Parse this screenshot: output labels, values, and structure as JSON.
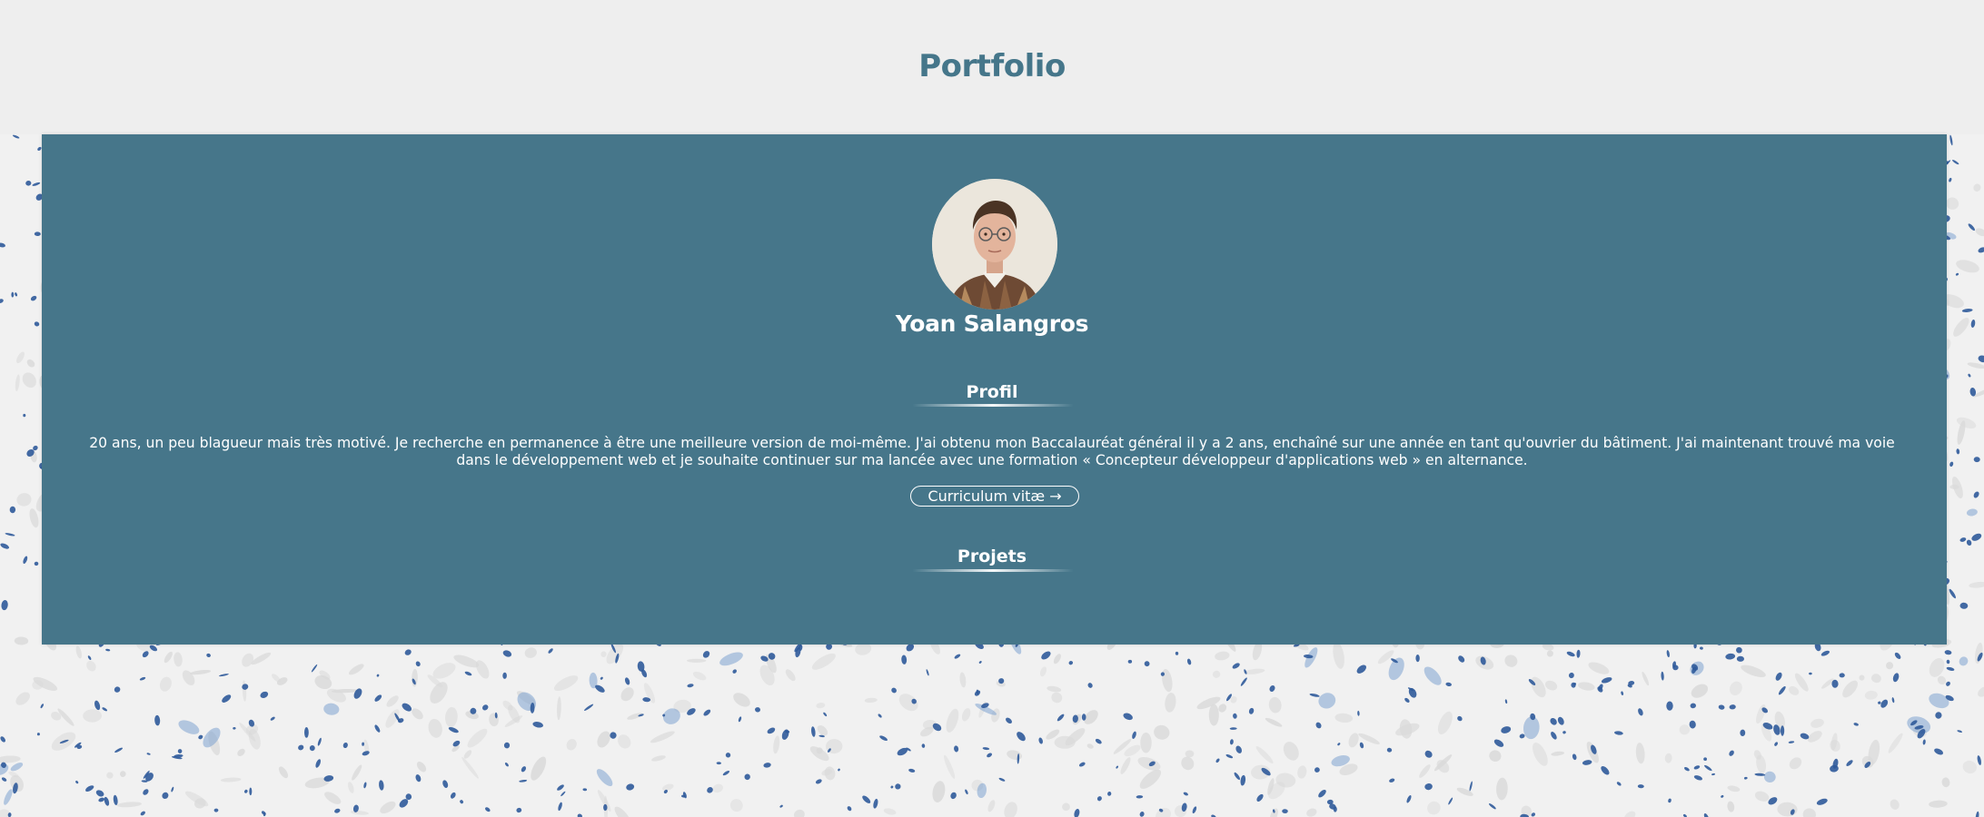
{
  "header": {
    "title": "Portfolio"
  },
  "profile": {
    "avatar_icon": "portrait-photo",
    "name": "Yoan Salangros"
  },
  "sections": {
    "profil": {
      "title": "Profil",
      "text": "20 ans, un peu blagueur mais très motivé. Je recherche en permanence à être une meilleure version de moi-même. J'ai obtenu mon Baccalauréat général il y a 2 ans, enchaîné sur une année en tant qu'ouvrier du bâtiment. J'ai maintenant trouvé ma voie dans le développement web et je souhaite continuer sur ma lancée avec une formation « Concepteur développeur d'applications web » en alternance.",
      "cv_button_label": "Curriculum vitæ →"
    },
    "projets": {
      "title": "Projets"
    }
  },
  "colors": {
    "title": "#45768a",
    "panel": "#46768a",
    "header_bg": "#eeeeee",
    "pattern_blue": "#2f5a9a",
    "pattern_grey": "#d9d9d9"
  }
}
